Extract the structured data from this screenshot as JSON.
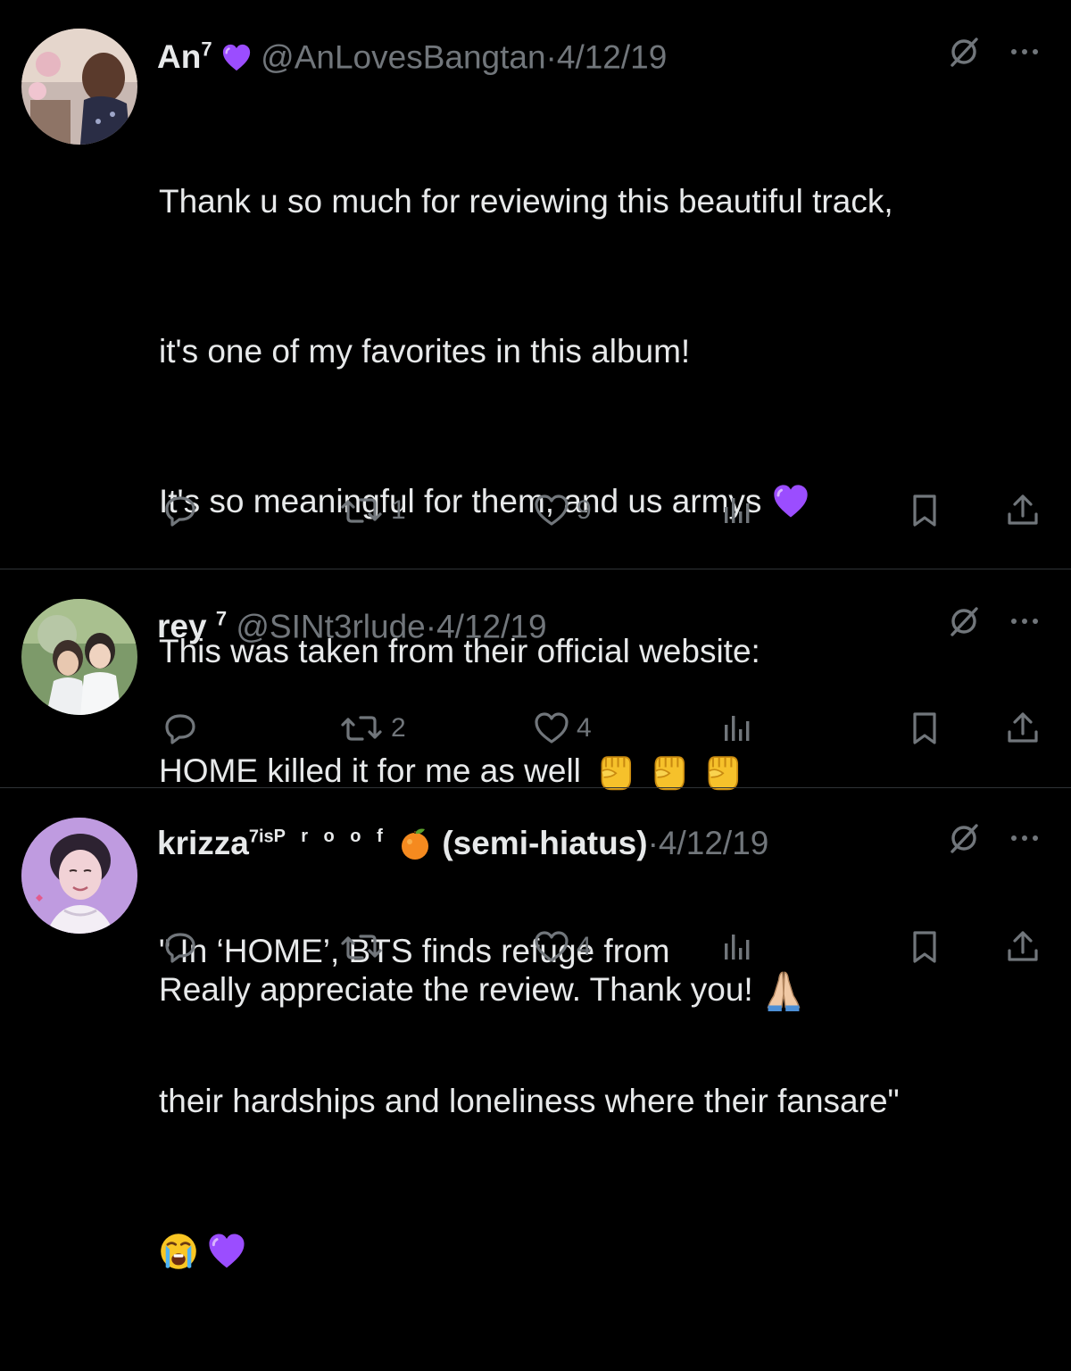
{
  "tweets": [
    {
      "name": "An",
      "name_sup": "7",
      "handle": "@AnLovesBangtan",
      "sep": "·",
      "date": "4/12/19",
      "text_lines": [
        "Thank u so much for reviewing this beautiful track,",
        "it's one of my favorites in this album!",
        "It's so meaningful for them, and us armys",
        "This was taken from their official website:",
        "",
        "\" In ‘HOME’, BTS finds refuge from",
        "their hardships and loneliness where their fansare\""
      ],
      "icons": [
        "purple-heart-emoji",
        "crying-face-emoji"
      ],
      "reply_count": "",
      "retweet_count": "1",
      "like_count": "9"
    },
    {
      "name": "rey",
      "name_sup": "7",
      "handle": "@SINt3rlude",
      "sep": "·",
      "date": "4/12/19",
      "text_lines": [
        "HOME killed it for me as well"
      ],
      "icons": [
        "raised-fist-emoji"
      ],
      "reply_count": "",
      "retweet_count": "2",
      "like_count": "4"
    },
    {
      "name": "krizza",
      "name_sup": "7is",
      "name_tail": "P r o o f",
      "name_suffix": "(semi-hiatus)",
      "sep": "·",
      "date": "4/12/19",
      "text_lines": [
        "Really appreciate the review. Thank you!"
      ],
      "icons": [
        "orange-emoji",
        "folded-hands-emoji"
      ],
      "reply_count": "",
      "retweet_count": "",
      "like_count": "4"
    }
  ],
  "colors": {
    "background": "#000000",
    "text": "#e7e9ea",
    "muted": "#71767b",
    "divider": "#2f3336",
    "purple_heart": "#a855f7"
  }
}
